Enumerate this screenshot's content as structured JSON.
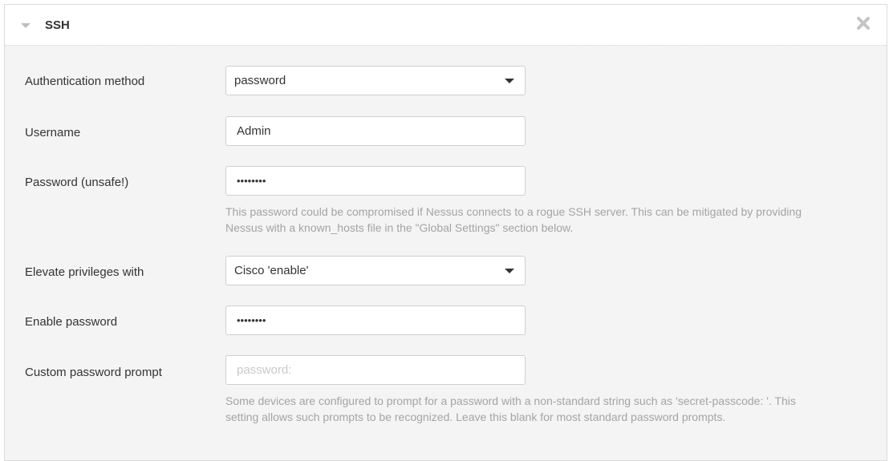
{
  "panel": {
    "title": "SSH",
    "collapse_icon": "triangle-down-icon",
    "close_icon": "close-x-icon"
  },
  "fields": {
    "auth_method": {
      "label": "Authentication method",
      "value": "password",
      "type": "select"
    },
    "username": {
      "label": "Username",
      "value": "Admin",
      "type": "text"
    },
    "password": {
      "label": "Password (unsafe!)",
      "value": "••••••••",
      "type": "password",
      "help": [
        "This password could be compromised if Nessus connects to a rogue SSH server. This can be mitigated by providing",
        "Nessus with a known_hosts file in the \"Global Settings\" section below."
      ]
    },
    "elevate": {
      "label": "Elevate privileges with",
      "value": "Cisco 'enable'",
      "type": "select"
    },
    "enable_password": {
      "label": "Enable password",
      "value": "••••••••",
      "type": "password"
    },
    "custom_prompt": {
      "label": "Custom password prompt",
      "value": "",
      "placeholder": "password:",
      "type": "text",
      "help": [
        "Some devices are configured to prompt for a password with a non-standard string such as 'secret-passcode: '. This",
        "setting allows such prompts to be recognized. Leave this blank for most standard password prompts."
      ]
    }
  }
}
